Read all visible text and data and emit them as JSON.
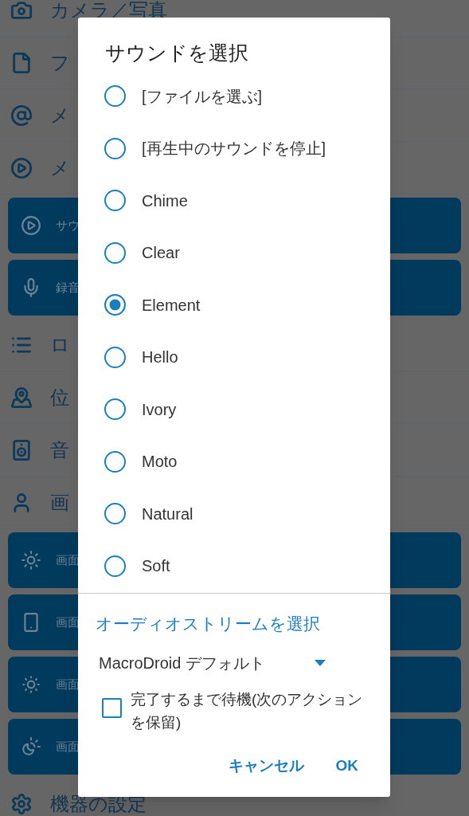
{
  "background_list": [
    {
      "kind": "row",
      "label": "カメラ／写真"
    },
    {
      "kind": "row",
      "label": "フ"
    },
    {
      "kind": "row",
      "label": "メ"
    },
    {
      "kind": "row",
      "label": "メ"
    },
    {
      "kind": "card",
      "label": "サウ"
    },
    {
      "kind": "card",
      "label": "録音"
    },
    {
      "kind": "row",
      "label": "ロ"
    },
    {
      "kind": "row",
      "label": "位"
    },
    {
      "kind": "row",
      "label": "音"
    },
    {
      "kind": "row",
      "label": "画"
    },
    {
      "kind": "card",
      "label": "画面"
    },
    {
      "kind": "card",
      "label": "画面"
    },
    {
      "kind": "card",
      "label": "画面"
    },
    {
      "kind": "card",
      "label": "画面"
    },
    {
      "kind": "row",
      "label": "機器の設定"
    }
  ],
  "dialog": {
    "title": "サウンドを選択",
    "options": [
      {
        "label": "[ファイルを選ぶ]",
        "selected": false
      },
      {
        "label": "[再生中のサウンドを停止]",
        "selected": false
      },
      {
        "label": "Chime",
        "selected": false
      },
      {
        "label": "Clear",
        "selected": false
      },
      {
        "label": "Element",
        "selected": true
      },
      {
        "label": "Hello",
        "selected": false
      },
      {
        "label": "Ivory",
        "selected": false
      },
      {
        "label": "Moto",
        "selected": false
      },
      {
        "label": "Natural",
        "selected": false
      },
      {
        "label": "Soft",
        "selected": false
      }
    ],
    "stream_link": "オーディオストリームを選択",
    "stream_dropdown": {
      "value": "MacroDroid デフォルト"
    },
    "wait_checkbox": {
      "label": "完了するまで待機(次のアクションを保留)",
      "checked": false
    },
    "buttons": [
      {
        "label": "キャンセル"
      },
      {
        "label": "OK"
      }
    ]
  }
}
